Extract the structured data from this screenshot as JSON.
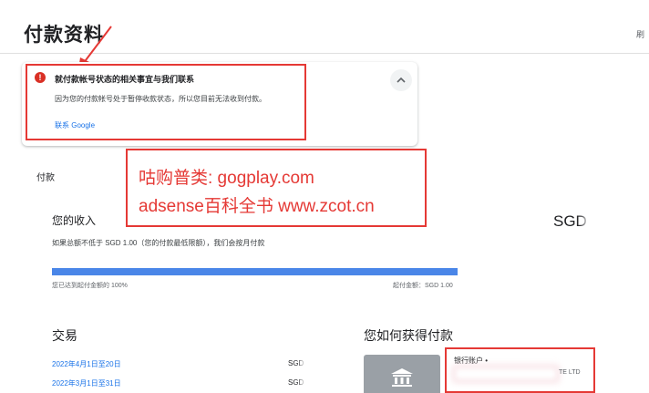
{
  "page": {
    "title": "付款资料",
    "top_right_text": "刷"
  },
  "alert": {
    "icon": "error-icon",
    "icon_glyph": "!",
    "title": "就付款帐号状态的相关事宜与我们联系",
    "body": "因为您的付款帐号处于暂停收款状态，所以您目前无法收到付款。",
    "link": "联系 Google",
    "collapse_icon": "chevron-up-icon"
  },
  "payments_section": {
    "label": "付款"
  },
  "watermark": {
    "line1": "咕购普类: gogplay.com",
    "line2": "adsense百科全书 www.zcot.cn"
  },
  "income": {
    "title": "您的收入",
    "amount": "SGD",
    "description": "如果总额不低于 SGD 1.00（您的付款最低限额），我们会按月付款",
    "progress_fraction": 1.0,
    "progress_left_label": "您已达到起付金额的 100%",
    "progress_right_label": "起付金额：SGD 1.00"
  },
  "transactions": {
    "title": "交易",
    "rows": [
      {
        "date": "2022年4月1日至20日",
        "amount": "SGD"
      },
      {
        "date": "2022年3月1日至31日",
        "amount": "SGD"
      }
    ]
  },
  "payout": {
    "title": "您如何获得付款",
    "bank_icon": "bank-icon",
    "bank_label": "银行账户 •",
    "bank_company": "TE LTD"
  },
  "colors": {
    "accent": "#1a73e8",
    "error": "#d93025",
    "highlight": "#e53935",
    "progress": "#4a86e8"
  }
}
